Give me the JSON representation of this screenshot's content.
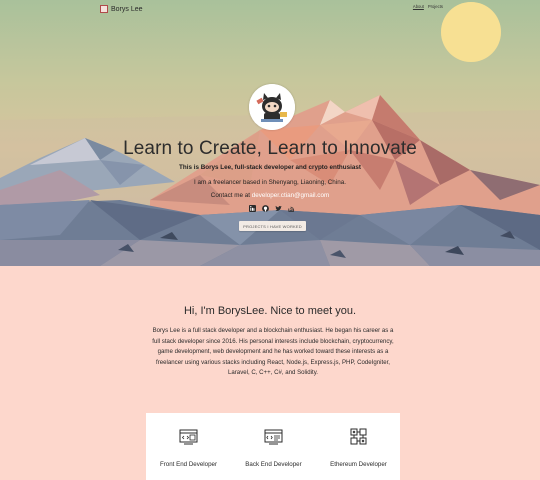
{
  "nav": {
    "brand": "Borys Lee",
    "links": [
      {
        "label": "About",
        "active": true
      },
      {
        "label": "Projects",
        "active": false
      }
    ]
  },
  "hero": {
    "title": "Learn to Create, Learn to Innovate",
    "tagline": "This is Borys Lee, full-stack developer and crypto enthusiast",
    "location": "I am a freelancer based in Shenyang, Liaoning, China.",
    "contact_label": "Contact me at",
    "email": "developer.ctian@gmail.com",
    "socials": [
      "linkedin-icon",
      "github-icon",
      "twitter-icon",
      "stackoverflow-icon"
    ],
    "cta": "PROJECTS I HAVE WORKED"
  },
  "intro": {
    "heading": "Hi, I'm BorysLee. Nice to meet you.",
    "body": "Borys Lee is a full stack developer and a blockchain enthusiast. He began his career as a full stack developer since 2016. His personal interests include blockchain, cryptocurrency, game development, web development and he has worked toward these interests as a freelancer using various stacks including React, Node.js, Express.js, PHP, CodeIgniter, Laravel, C, C++, C#, and Solidity."
  },
  "services": [
    {
      "label": "Front End Developer",
      "icon": "frontend-code-icon"
    },
    {
      "label": "Back End Developer",
      "icon": "backend-code-icon"
    },
    {
      "label": "Ethereum Developer",
      "icon": "ethereum-blocks-icon"
    }
  ],
  "colors": {
    "page_bg": "#fdd7cc",
    "sun": "#f6dc8a",
    "accent": "#b04a4a"
  }
}
